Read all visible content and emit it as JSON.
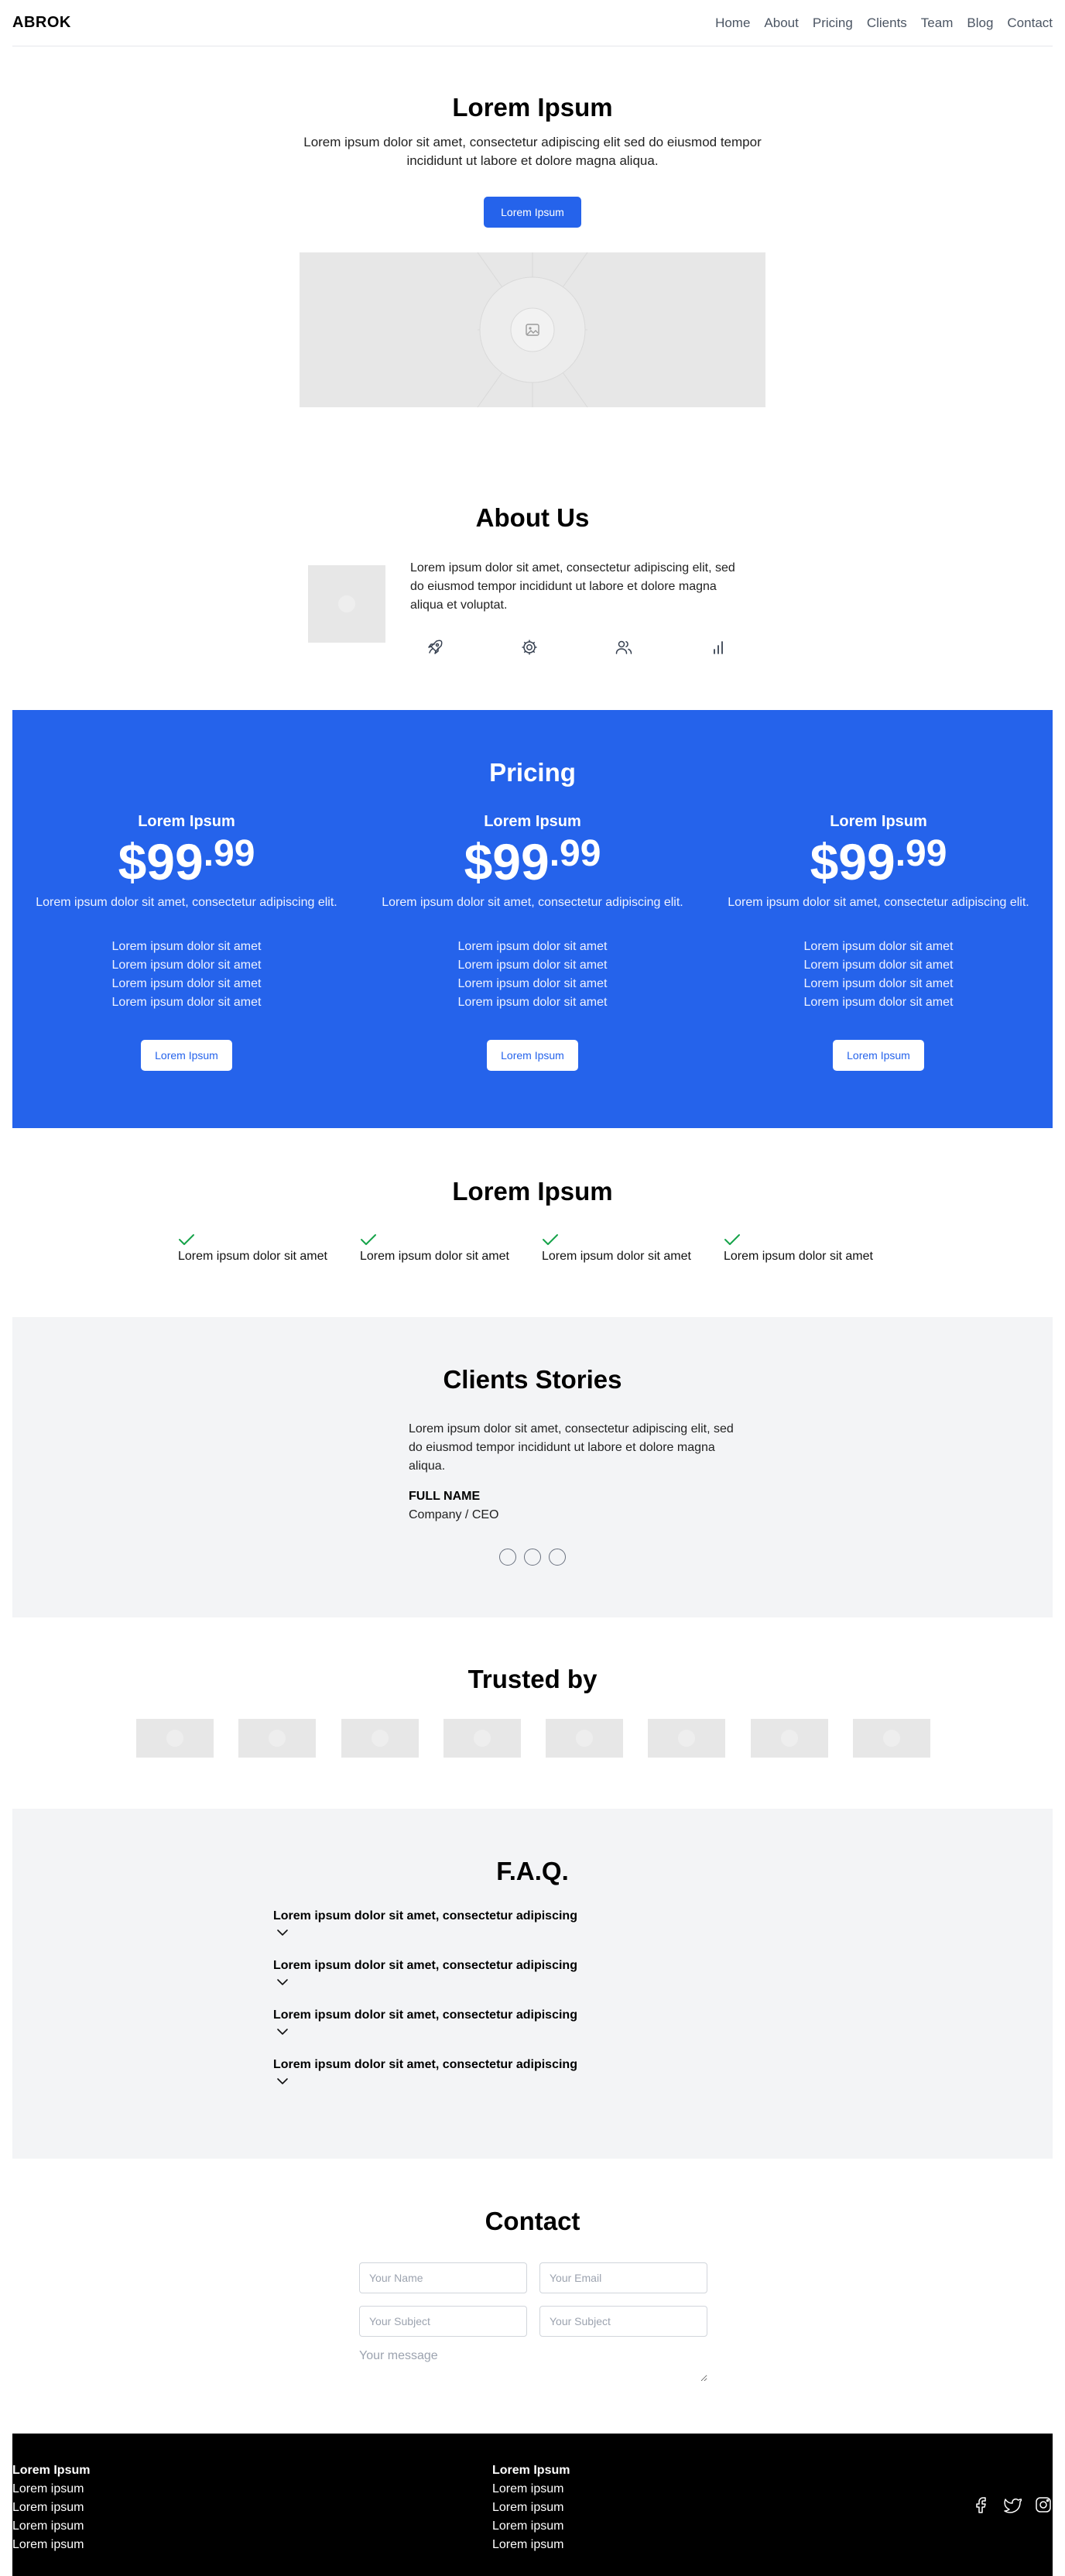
{
  "nav": {
    "logo": "ABROK",
    "links": [
      "Home",
      "About",
      "Pricing",
      "Clients",
      "Team",
      "Blog",
      "Contact"
    ]
  },
  "hero": {
    "title": "Lorem Ipsum",
    "text": "Lorem ipsum dolor sit amet, consectetur adipiscing elit sed do eiusmod tempor incididunt ut labore et dolore magna aliqua.",
    "button": "Lorem Ipsum",
    "image_icon": "image-icon"
  },
  "about": {
    "title": "About Us",
    "text": "Lorem ipsum dolor sit amet, consectetur adipiscing elit, sed do eiusmod tempor incididunt ut labore et dolore magna aliqua et voluptat.",
    "icons": [
      "rocket-icon",
      "gear-icon",
      "users-icon",
      "bar-chart-icon"
    ]
  },
  "pricing": {
    "title": "Pricing",
    "accent": "#2563eb",
    "plans": [
      {
        "name": "Lorem Ipsum",
        "price_main": "$99",
        "price_cents": ".99",
        "description": "Lorem ipsum dolor sit amet, consectetur adipiscing elit.",
        "features": [
          "Lorem ipsum dolor sit amet",
          "Lorem ipsum dolor sit amet",
          "Lorem ipsum dolor sit amet",
          "Lorem ipsum dolor sit amet"
        ],
        "button": "Lorem Ipsum"
      },
      {
        "name": "Lorem Ipsum",
        "price_main": "$99",
        "price_cents": ".99",
        "description": "Lorem ipsum dolor sit amet, consectetur adipiscing elit.",
        "features": [
          "Lorem ipsum dolor sit amet",
          "Lorem ipsum dolor sit amet",
          "Lorem ipsum dolor sit amet",
          "Lorem ipsum dolor sit amet"
        ],
        "button": "Lorem Ipsum"
      },
      {
        "name": "Lorem Ipsum",
        "price_main": "$99",
        "price_cents": ".99",
        "description": "Lorem ipsum dolor sit amet, consectetur adipiscing elit.",
        "features": [
          "Lorem ipsum dolor sit amet",
          "Lorem ipsum dolor sit amet",
          "Lorem ipsum dolor sit amet",
          "Lorem ipsum dolor sit amet"
        ],
        "button": "Lorem Ipsum"
      }
    ]
  },
  "features": {
    "title": "Lorem Ipsum",
    "check_color": "#16a34a",
    "items": [
      "Lorem ipsum dolor sit amet",
      "Lorem ipsum dolor sit amet",
      "Lorem ipsum dolor sit amet",
      "Lorem ipsum dolor sit amet"
    ]
  },
  "clients": {
    "title": "Clients Stories",
    "quote": "Lorem ipsum dolor sit amet, consectetur adipiscing elit, sed do eiusmod tempor incididunt ut labore et dolore magna aliqua.",
    "name": "FULL NAME",
    "role": "Company / CEO",
    "slides": 3
  },
  "trusted": {
    "title": "Trusted by",
    "logo_count": 8
  },
  "faq": {
    "title": "F.A.Q.",
    "items": [
      "Lorem ipsum dolor sit amet, consectetur adipiscing",
      "Lorem ipsum dolor sit amet, consectetur adipiscing",
      "Lorem ipsum dolor sit amet, consectetur adipiscing",
      "Lorem ipsum dolor sit amet, consectetur adipiscing"
    ]
  },
  "contact": {
    "title": "Contact",
    "name_placeholder": "Your Name",
    "email_placeholder": "Your Email",
    "subject_placeholder": "Your Subject",
    "subject2_placeholder": "Your Subject",
    "message_placeholder": "Your message"
  },
  "footer": {
    "col1": {
      "heading": "Lorem Ipsum",
      "links": [
        "Lorem ipsum",
        "Lorem ipsum",
        "Lorem ipsum",
        "Lorem ipsum"
      ]
    },
    "col2": {
      "heading": "Lorem Ipsum",
      "links": [
        "Lorem ipsum",
        "Lorem ipsum",
        "Lorem ipsum",
        "Lorem ipsum"
      ]
    },
    "social": [
      "facebook-icon",
      "twitter-icon",
      "instagram-icon"
    ]
  }
}
